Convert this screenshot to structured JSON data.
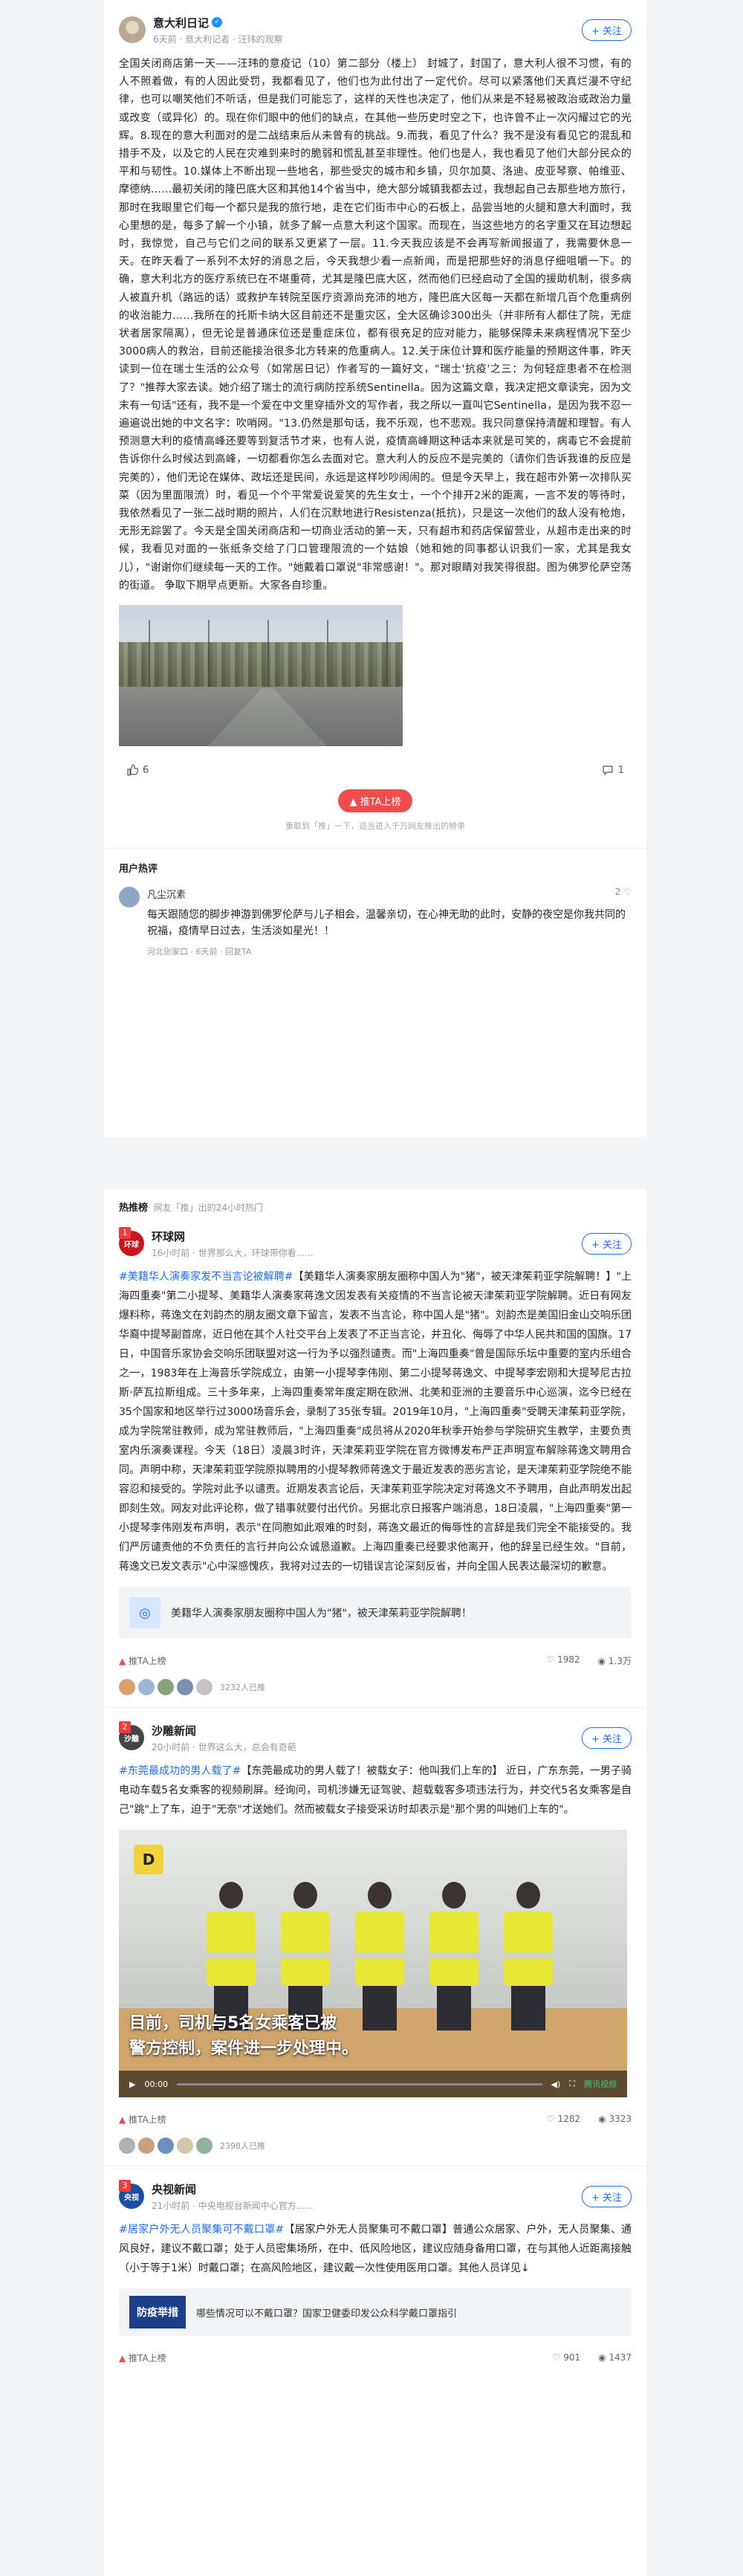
{
  "article": {
    "author": {
      "name": "意大利日记",
      "meta": "6天前 · 意大利记者 · 汪玮的观察",
      "follow_label": "+ 关注"
    },
    "paragraphs": [
      "全国关闭商店第一天——汪玮的意疫记（10）第二部分（楼上） 封城了，封国了，意大利人很不习惯，有的人不照着做，有的人因此受罚，我都看见了，他们也为此付出了一定代价。尽可以紧落他们天真烂漫不守纪律，也可以嘲笑他们不听话，但是我们可能忘了，这样的天性也决定了，他们从来是不轻易被政治或政治力量或改变（或异化）的。现在你们眼中的他们的缺点，在其他一些历史时空之下，也许曾不止一次闪耀过它的光辉。8.现在的意大利面对的是二战结束后从未曾有的挑战。9.而我，看见了什么？我不是没有看见它的混乱和措手不及，以及它的人民在灾难到来时的脆弱和慌乱甚至非理性。他们也是人，我也看见了他们大部分民众的平和与韧性。",
      "10.媒体上不断出现一些地名，那些受灾的城市和乡镇，贝尔加莫、洛迪、皮亚琴察、帕维亚、摩德纳……最初关闭的隆巴底大区和其他14个省当中，绝大部分城镇我都去过，我想起自己去那些地方旅行，那时在我眼里它们每一个都只是我的旅行地，走在它们街市中心的石板上，品尝当地的火腿和意大利面时，我心里想的是，每多了解一个小镇，就多了解一点意大利这个国家。而现在，当这些地方的名字重又在耳边想起时，我惊觉，自己与它们之间的联系又更紧了一层。11.今天我应该是不会再写新闻报道了，我需要休息一天。在昨天看了一系列不太好的消息之后，今天我想少看一点新闻，而是把那些好的消息仔细咀嚼一下。的确，意大利北方的医疗系统已在不堪重荷，尤其是隆巴底大区，然而他们已经启动了全国的援助机制，很多病人被直升机（路远的话）或救护车转院至医疗资源尚充沛的地方，隆巴底大区每一天都在新增几百个危重病例的收治能力……我所在的托斯卡纳大区目前还不是重灾区，全大区确诊300出头（并非所有人都住了院，无症状者居家隔离），但无论是普通床位还是重症床位，都有很充足的应对能力，能够保障未来病程情况下至少3000病人的救治，目前还能接治很多北方转来的危重病人。12.关于床位计算和医疗能量的预期这件事，昨天读到一位在瑞士生活的公众号（如常居日记）作者写的一篇好文，\"瑞士'抗疫'之三：为何轻症患者不在检测了？\"推荐大家去读。她介绍了瑞士的流行病防控系统Sentinella。因为这篇文章，我决定把文章读完，因为文末有一句话\"还有，我不是一个爱在中文里穿插外文的写作者，我之所以一直叫它Sentinella，是因为我不忍一遍遍说出她的中文名字：吹哨网。\"13.仍然是那句话，我不乐观，也不悲观。我只同意保持清醒和理智。有人预测意大利的疫情高峰还要等到复活节才来，也有人说，疫情高峰期这种话本来就是可笑的，病毒它不会提前告诉你什么时候达到高峰，一切都看你怎么去面对它。意大利人的反应不是完美的（请你们告诉我谁的反应是完美的），他们无论在媒体、政坛还是民间，永远是这样吵吵闹闹的。但是今天早上，我在超市外第一次排队买菜（因为里面限流）时，看见一个个平常爱说爱笑的先生女士，一个个排开2米的距离，一言不发的等待时，我依然看见了一张二战时期的照片，人们在沉默地进行Resistenza(抵抗)，只是这一次他们的敌人没有枪炮，无形无踪罢了。",
      "今天是全国关闭商店和一切商业活动的第一天，只有超市和药店保留营业，从超市走出来的时候，我看见对面的一张纸条交给了门口管理限流的一个姑娘（她和她的同事都认识我们一家，尤其是我女儿），\"谢谢你们继续每一天的工作。\"她戴着口罩说\"非常感谢！\"。那对眼睛对我笑得很甜。图为佛罗伦萨空荡的街道。 争取下期早点更新。大家各自珍重。"
    ],
    "likes": "6",
    "comments": "1",
    "push_label": "推TA上榜",
    "push_tip": "重取到「推」一下，适当进入千万网友推出的榜单"
  },
  "comments_section": {
    "title": "用户热评",
    "items": [
      {
        "user": "凡尘沉素",
        "likes": "2",
        "text": "每天跟随您的脚步神游到佛罗伦萨与儿子相会，温馨亲切，在心神无助的此时，安静的夜空是你我共同的祝福，疫情早日过去，生活淡如星光！！",
        "meta": "河北张家口 · 6天前 · 回复TA"
      }
    ]
  },
  "hot": {
    "header_title": "热推榜",
    "header_sub": "· 网友「推」出的24小时热门",
    "items": [
      {
        "rank": "1",
        "source": "环球网",
        "source_meta": "16小时前 · 世界那么大，环球带你看......",
        "follow_label": "+ 关注",
        "hashtag": "#美籍华人演奏家发不当言论被解聘#",
        "body": "【美籍华人演奏家朋友圈称中国人为\"猪\"，被天津茱莉亚学院解聘！】\"上海四重奏\"第二小提琴、美籍华人演奏家蒋逸文因发表有关疫情的不当言论被天津茱莉亚学院解聘。近日有网友爆料称，蒋逸文在刘韵杰的朋友圈文章下留言，发表不当言论，称中国人是\"猪\"。刘韵杰是美国旧金山交响乐团华裔中提琴副首席，近日他在其个人社交平台上发表了不正当言论，并丑化、侮辱了中华人民共和国的国旗。17日，中国音乐家协会交响乐团联盟对这一行为予以强烈谴责。而\"上海四重奏\"曾是国际乐坛中重要的室内乐组合之一，1983年在上海音乐学院成立，由第一小提琴李伟刚、第二小提琴蒋逸文、中提琴李宏刚和大提琴尼古拉斯·萨瓦拉斯组成。三十多年来，上海四重奏常年度定期在欧洲、北美和亚洲的主要音乐中心巡演，迄今已经在35个国家和地区举行过3000场音乐会，录制了35张专辑。2019年10月，\"上海四重奏\"受聘天津茱莉亚学院，成为学院常驻教师，成为常驻教师后，\"上海四重奏\"成员将从2020年秋季开始参与学院研究生教学，主要负责室内乐演奏课程。今天（18日）凌晨3时许，天津茱莉亚学院在官方微博发布严正声明宣布解除蒋逸文聘用合同。声明中称，天津茱莉亚学院原拟聘用的小提琴教师蒋逸文于最近发表的恶劣言论，是天津茱莉亚学院绝不能容忍和接受的。学院对此予以谴责。近期发表言论后，天津茱莉亚学院决定对蒋逸文不予聘用，自此声明发出起即刻生效。网友对此评论称，做了错事就要付出代价。另据北京日报客户端消息，18日凌晨，\"上海四重奏\"第一小提琴李伟刚发布声明，表示\"在同胞如此艰难的时刻，蒋逸文最近的侮辱性的言辞是我们完全不能接受的。我们严厉谴责他的不负责任的言行并向公众诚恳道歉。上海四重奏已经要求他离开，他的辞呈已经生效。\"目前，蒋逸文已发文表示\"心中深感愧疚，我将对过去的一切错误言论深刻反省，并向全国人民表达最深切的歉意。",
        "quote": "美籍华人演奏家朋友圈称中国人为\"猪\"，被天津茱莉亚学院解聘！",
        "push_label": "推TA上榜",
        "likes": "1982",
        "views": "1.3万",
        "pushers": "3232人已推"
      },
      {
        "rank": "2",
        "source": "沙雕新闻",
        "source_meta": "20小时前 · 世界这么大，总会有奇葩",
        "follow_label": "+ 关注",
        "hashtag": "#东莞最成功的男人载了#",
        "body": "【东莞最成功的男人载了！被载女子：他叫我们上车的】 近日，广东东莞，一男子骑电动车载5名女乘客的视频刷屏。经询问，司机涉嫌无证驾驶、超载载客多项违法行为，并交代5名女乘客是自己\"跳\"上了车，迫于\"无奈\"才送她们。然而被载女子接受采访时却表示是\"那个男的叫她们上车的\"。",
        "video_caption_1": "目前，司机与5名女乘客已被",
        "video_caption_2": "警方控制，案件进一步处理中。",
        "video_time": "00:00",
        "video_brand": "腾讯视频",
        "push_label": "推TA上榜",
        "likes": "1282",
        "views": "3323",
        "pushers": "2398人已推"
      },
      {
        "rank": "3",
        "source": "央视新闻",
        "source_meta": "21小时前 · 中央电视台新闻中心官方......",
        "follow_label": "+ 关注",
        "hashtag": "#居家户外无人员聚集可不戴口罩#",
        "body": "【居家户外无人员聚集可不戴口罩】普通公众居家、户外，无人员聚集、通风良好，建议不戴口罩；处于人员密集场所，在中、低风险地区，建议应随身备用口罩，在与其他人近距离接触（小于等于1米）时戴口罩；在高风险地区，建议戴一次性使用医用口罩。其他人员详见↓",
        "quote": "哪些情况可以不戴口罩？国家卫健委印发公众科学戴口罩指引",
        "quote_thumb": "防疫举措",
        "push_label": "推TA上榜",
        "likes": "901",
        "views": "1437"
      }
    ]
  },
  "colors": {
    "accent": "#1f6ff5",
    "hot_red": "#ef4d4d",
    "background": "#f4f5f7"
  }
}
